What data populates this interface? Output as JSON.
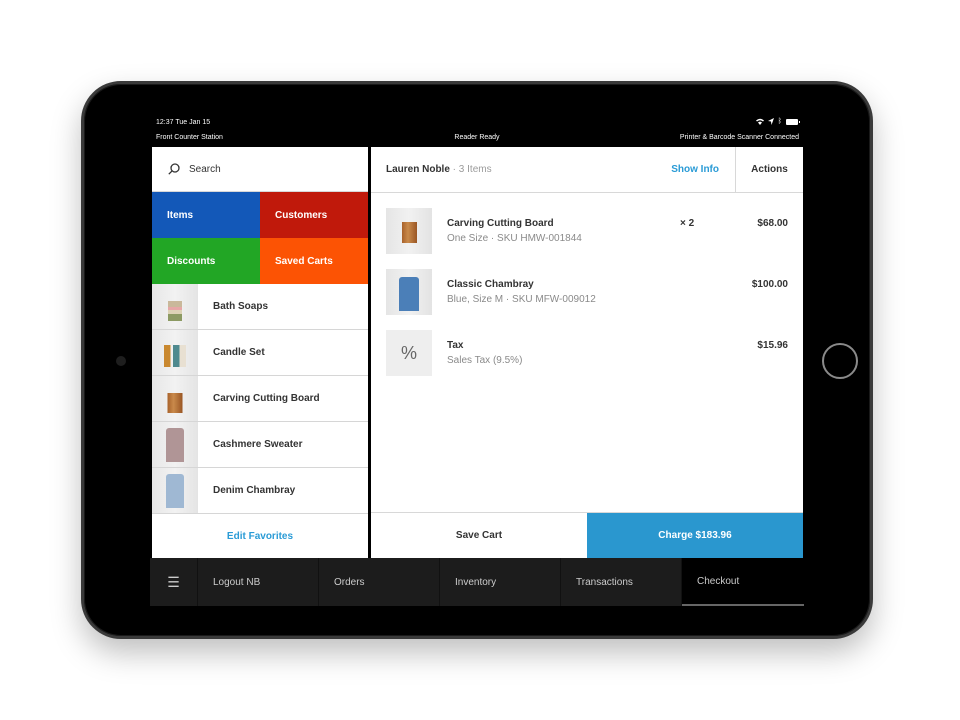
{
  "status_bar": {
    "time": "12:37 Tue Jan 15",
    "icons": [
      "wifi-icon",
      "location-icon",
      "bluetooth-icon",
      "battery-icon"
    ],
    "station": "Front Counter Station",
    "reader_status": "Reader Ready",
    "peripherals_status": "Printer & Barcode Scanner Connected"
  },
  "left_panel": {
    "search": {
      "placeholder": "Search",
      "icon": "search-icon"
    },
    "tiles": [
      {
        "label": "Items",
        "color": "#1358b8"
      },
      {
        "label": "Customers",
        "color": "#c0190b"
      },
      {
        "label": "Discounts",
        "color": "#22a625"
      },
      {
        "label": "Saved Carts",
        "color": "#fc5304"
      }
    ],
    "favorites": [
      {
        "name": "Bath Soaps"
      },
      {
        "name": "Candle Set"
      },
      {
        "name": "Carving Cutting Board"
      },
      {
        "name": "Cashmere Sweater"
      },
      {
        "name": "Denim Chambray"
      }
    ],
    "edit_favorites": "Edit Favorites"
  },
  "cart": {
    "customer": "Lauren Noble",
    "item_count": " · 3 Items",
    "show_info": "Show Info",
    "actions": "Actions",
    "items": [
      {
        "title": "Carving Cutting Board",
        "subtitle": "One Size · SKU HMW-001844",
        "qty": "× 2",
        "price": "$68.00"
      },
      {
        "title": "Classic Chambray",
        "subtitle": "Blue, Size M · SKU MFW-009012",
        "qty": "",
        "price": "$100.00"
      },
      {
        "title": "Tax",
        "subtitle": "Sales Tax (9.5%)",
        "qty": "",
        "price": "$15.96",
        "icon": "%"
      }
    ],
    "save_cart": "Save Cart",
    "charge": "Charge $183.96",
    "accent": "#2a97cf"
  },
  "bottom_nav": {
    "menu_icon": "☰",
    "tabs": [
      {
        "label": "Logout NB"
      },
      {
        "label": "Orders"
      },
      {
        "label": "Inventory"
      },
      {
        "label": "Transactions"
      },
      {
        "label": "Checkout",
        "active": true
      }
    ]
  }
}
